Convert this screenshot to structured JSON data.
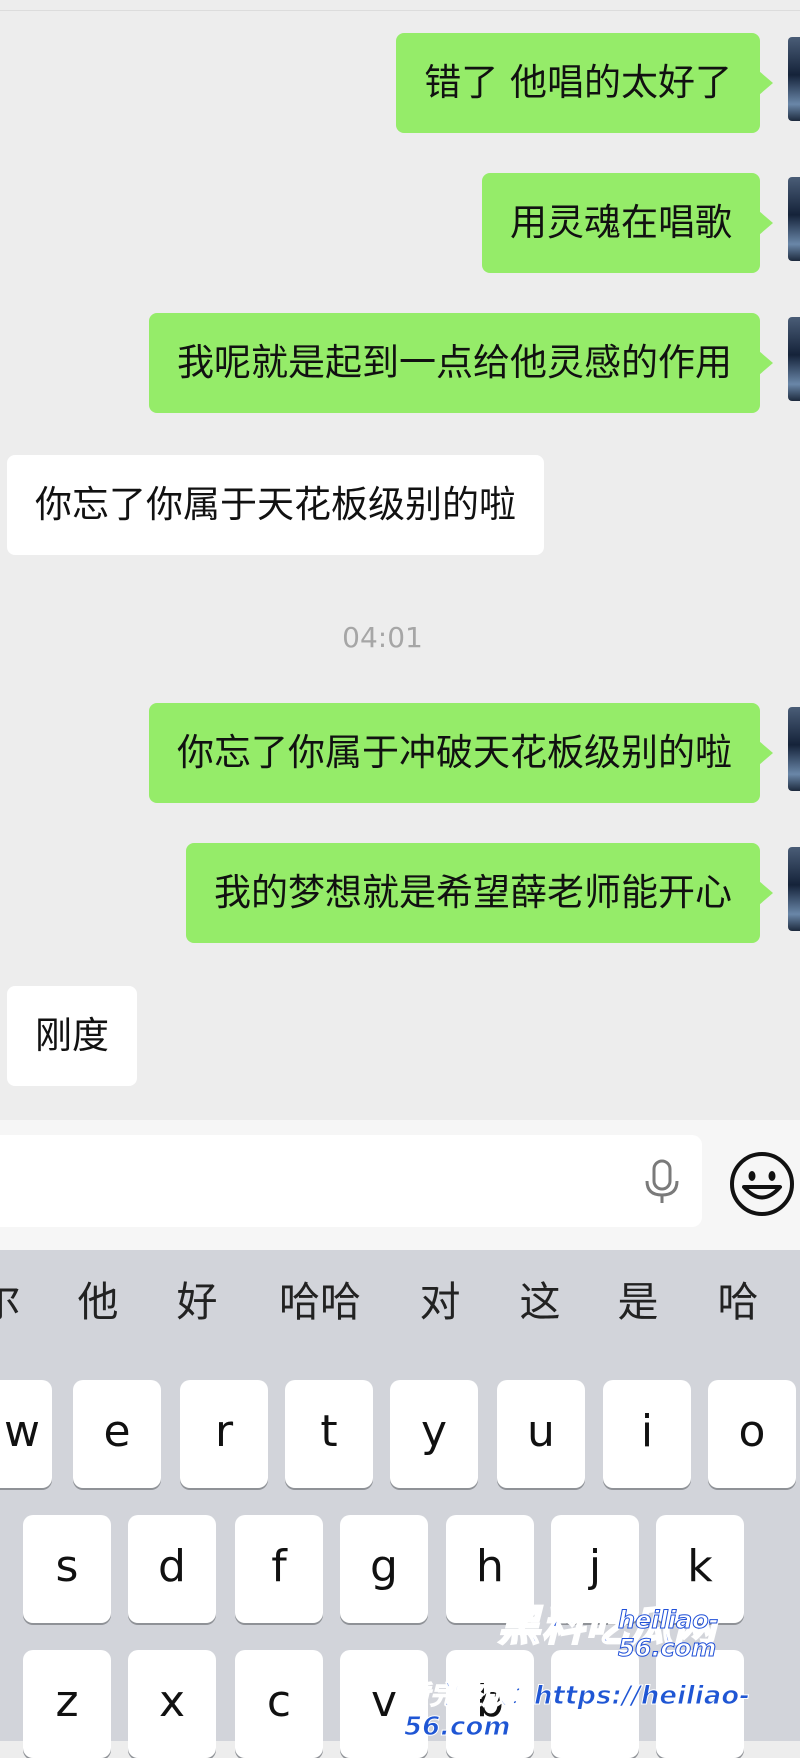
{
  "messages": [
    {
      "text": "错了 他唱的太好了",
      "side": "out"
    },
    {
      "text": "用灵魂在唱歌",
      "side": "out"
    },
    {
      "text": "我呢就是起到一点给他灵感的作用",
      "side": "out"
    },
    {
      "text": "你忘了你属于天花板级别的啦",
      "side": "in"
    },
    {
      "text": "你忘了你属于冲破天花板级别的啦",
      "side": "out"
    },
    {
      "text": "我的梦想就是希望薛老师能开心",
      "side": "out"
    },
    {
      "text": "刚度",
      "side": "in"
    }
  ],
  "timestamp": "04:01",
  "input_bar": {
    "value": "",
    "mic_icon": "microphone-icon",
    "emoji_icon": "emoji-smiley-icon"
  },
  "keyboard": {
    "candidates": [
      "尔",
      "他",
      "好",
      "哈哈",
      "对",
      "这",
      "是",
      "哈"
    ],
    "row1": [
      "w",
      "e",
      "r",
      "t",
      "y",
      "u",
      "i",
      "o"
    ],
    "row2": [
      "s",
      "d",
      "f",
      "g",
      "h",
      "j",
      "k"
    ],
    "row3": [
      "z",
      "x",
      "c",
      "v",
      "b"
    ]
  },
  "watermark": {
    "brand": "黑料吃瓜网",
    "domain": "heiliao-56.com",
    "line2": "看完整版：https://heiliao-56.com"
  },
  "colors": {
    "outgoing_bubble": "#95ec69",
    "incoming_bubble": "#ffffff",
    "chat_background": "#ededed",
    "keyboard_background": "#d2d4da",
    "watermark_blue": "#2050d8"
  }
}
